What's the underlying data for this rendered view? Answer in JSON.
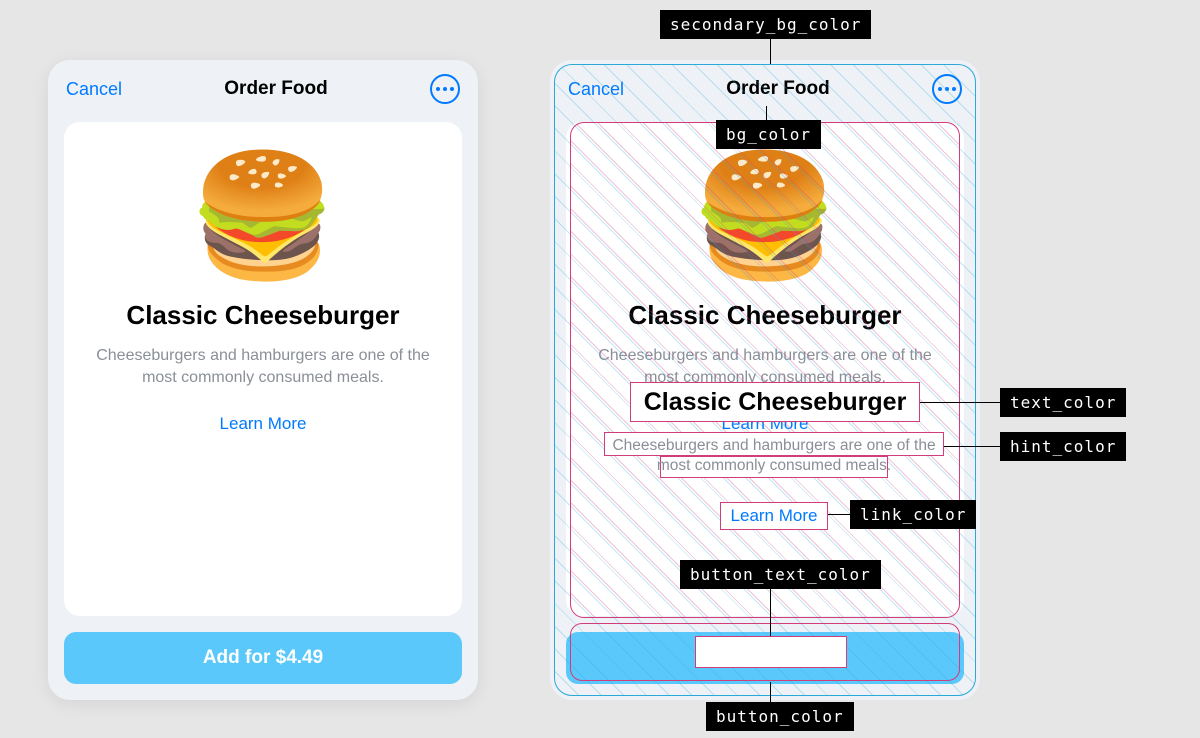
{
  "header": {
    "cancel_label": "Cancel",
    "title": "Order Food"
  },
  "item": {
    "emoji": "🍔",
    "name": "Classic Cheeseburger",
    "description": "Cheeseburgers and hamburgers are one of the most commonly consumed meals.",
    "learn_more_label": "Learn More"
  },
  "cta": {
    "label": "Add for $4.49"
  },
  "annotations": {
    "secondary_bg_color": "secondary_bg_color",
    "bg_color": "bg_color",
    "text_color": "text_color",
    "hint_color": "hint_color",
    "link_color": "link_color",
    "button_text_color": "button_text_color",
    "button_color": "button_color"
  },
  "colors": {
    "secondary_bg_color": "#eef2f7",
    "bg_color": "#ffffff",
    "text_color": "#000000",
    "hint_color": "#8a8f97",
    "link_color": "#007aff",
    "button_color": "#5ac8fa",
    "button_text_color": "#ffffff"
  }
}
